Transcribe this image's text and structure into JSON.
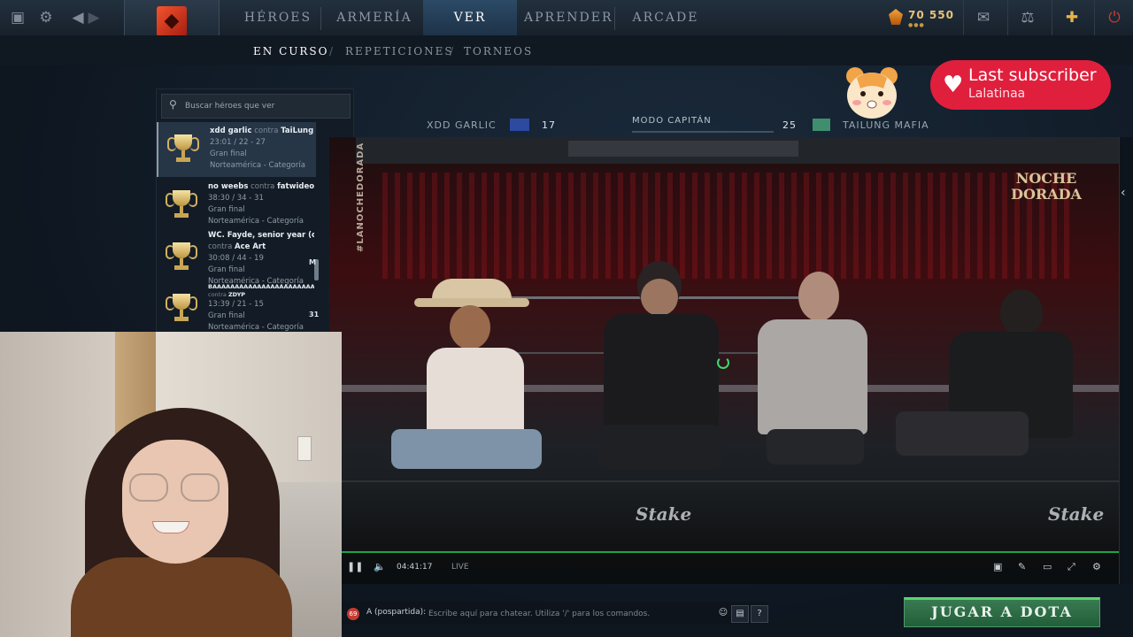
{
  "topbar": {
    "nav": [
      {
        "label": "HÉROES"
      },
      {
        "label": "ARMERÍA"
      },
      {
        "label": "VER"
      },
      {
        "label": "APRENDER"
      },
      {
        "label": "ARCADE"
      }
    ],
    "shards": "70 550"
  },
  "subnav": {
    "tabs": [
      {
        "label": "EN CURSO"
      },
      {
        "label": "REPETICIONES"
      },
      {
        "label": "TORNEOS"
      }
    ],
    "separator": "/"
  },
  "search": {
    "placeholder": "Buscar héroes que ver"
  },
  "matches": [
    {
      "team1": "xdd garlic",
      "vs": "contra",
      "team2": "TaiLung",
      "score": "23:01 / 22 - 27",
      "stage": "Gran final",
      "region": "Norteamérica - Categoría"
    },
    {
      "team1": "no weebs",
      "vs": "contra",
      "team2": "fatwideo",
      "score": "38:30 / 34 - 31",
      "stage": "Gran final",
      "region": "Norteamérica - Categoría"
    },
    {
      "team1": "WC. Fayde, senior year (cc",
      "vs": "contra",
      "team2": "Ace Art",
      "score": "30:08 / 44 - 19",
      "stage": "Gran final",
      "region": "Norteamérica - Categoría"
    },
    {
      "team1": "BAAAAAAAAAAAAAAAAAAAAAAAAAAAill",
      "vs": "contra",
      "team2": "ZDYP",
      "score": "13:39 / 21 - 15",
      "stage": "Gran final",
      "region": "Norteamérica - Categoría"
    }
  ],
  "list_peek": [
    "M",
    "31"
  ],
  "match_header": {
    "team_left": "XDD GARLIC",
    "score_left": "17",
    "mode": "MODO CAPITÁN",
    "score_right": "25",
    "team_right": "TAILUNG MAFIA"
  },
  "video": {
    "vertical_text": "#LANOCHEDORADA",
    "logo_text": "NOCHE DORADA",
    "sponsor": "Stake",
    "time": "04:41:17",
    "live": "LIVE"
  },
  "overlay": {
    "sub_title": "Last subscriber",
    "sub_name": "Lalatinaa"
  },
  "chat": {
    "badge": "69",
    "channel": "A (pospartida):",
    "placeholder": "Escribe aquí para chatear. Utiliza '/' para los comandos.",
    "help": "?"
  },
  "play_button": "JUGAR A DOTA",
  "colors": {
    "accent_red": "#e01f3d",
    "play_green": "#215e39",
    "live_green": "#19a64a"
  }
}
